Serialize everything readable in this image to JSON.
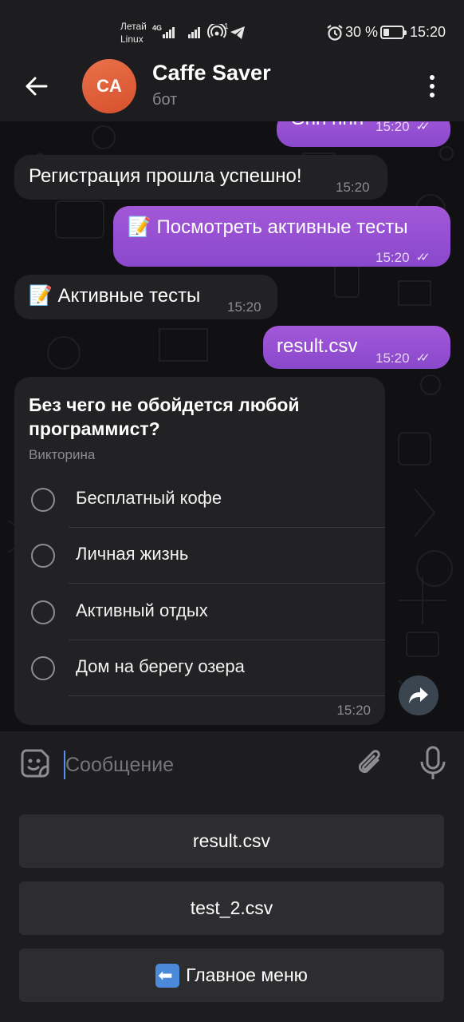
{
  "status": {
    "carrier_line1": "Летай",
    "carrier_line2": "Linux",
    "net": "4G",
    "hotspot_num": "1",
    "battery_pct": "30 %",
    "battery_level": 0.3,
    "time": "15:20"
  },
  "header": {
    "avatar_initials": "CA",
    "title": "Caffe Saver",
    "subtitle": "бот"
  },
  "messages": [
    {
      "dir": "out",
      "text": "Gnh hnh",
      "time": "15:20"
    },
    {
      "dir": "in",
      "text": "Регистрация прошла успешно!",
      "time": "15:20"
    },
    {
      "dir": "out",
      "text": "📝 Посмотреть активные тесты",
      "time": "15:20"
    },
    {
      "dir": "in",
      "text": "📝 Активные тесты",
      "time": "15:20"
    },
    {
      "dir": "out",
      "text": "result.csv",
      "time": "15:20"
    }
  ],
  "quiz": {
    "question": "Без чего не обойдется любой программист?",
    "type": "Викторина",
    "options": [
      "Бесплатный кофе",
      "Личная жизнь",
      "Активный отдых",
      "Дом на берегу озера"
    ],
    "time": "15:20"
  },
  "composer": {
    "placeholder": "Сообщение"
  },
  "keyboard": {
    "buttons": [
      "result.csv",
      "test_2.csv",
      "Главное меню"
    ]
  },
  "colors": {
    "outgoing": "#8f4fd1",
    "incoming": "#222224",
    "background": "#111113"
  }
}
